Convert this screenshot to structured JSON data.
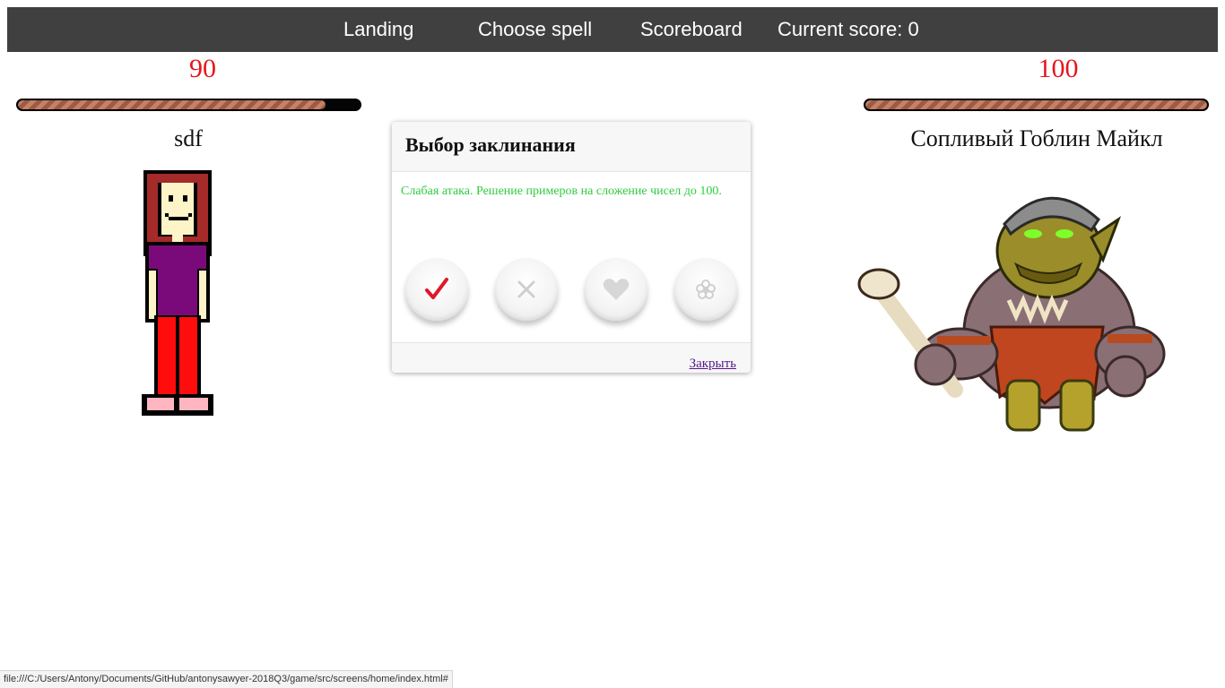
{
  "nav": {
    "landing": "Landing",
    "choose_spell": "Choose spell",
    "scoreboard": "Scoreboard",
    "current_score_label": "Current score: 0"
  },
  "player": {
    "name": "sdf",
    "hp": "90",
    "hp_fraction": 0.9
  },
  "enemy": {
    "name": "Сопливый Гоблин Майкл",
    "hp": "100",
    "hp_fraction": 1.0
  },
  "modal": {
    "title": "Выбор заклинания",
    "description": "Слабая атака. Решение примеров на сложение чисел до 100.",
    "close_label": "Закрыть",
    "spell_icons": [
      "checkmark-icon",
      "cross-icon",
      "heart-icon",
      "flower-icon"
    ]
  },
  "statusbar": {
    "url": "file:///C:/Users/Antony/Documents/GitHub/antonysawyer-2018Q3/game/src/screens/home/index.html#"
  },
  "colors": {
    "navbar": "#404040",
    "hp_text": "#e8141b",
    "description": "#2ecc40",
    "accent_check": "#e0172b"
  }
}
